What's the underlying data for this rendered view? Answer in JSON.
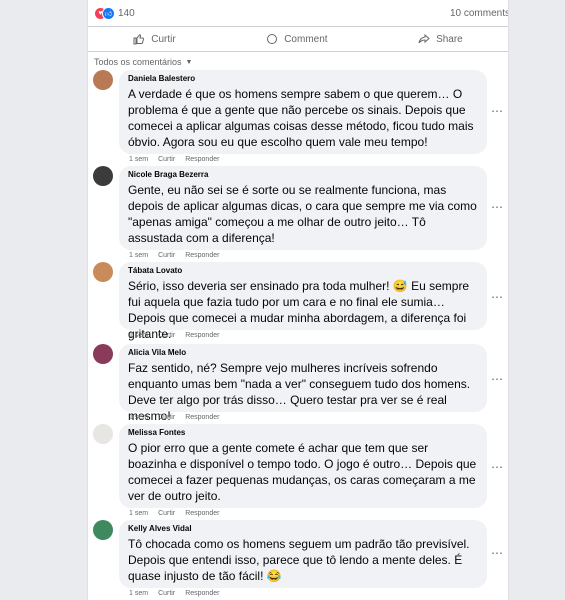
{
  "post": {
    "reaction_count": "140",
    "comments_count": "10 comments",
    "actions": {
      "like": "Curtir",
      "comment": "Comment",
      "share": "Share"
    },
    "sort_label": "Todos os comentários"
  },
  "comments": [
    {
      "author": "Daniela Balestero",
      "text": "A verdade é que os homens sempre sabem o que querem… O problema é que a gente que não percebe os sinais. Depois que comecei a aplicar algumas coisas desse método, ficou tudo mais óbvio. Agora sou eu que escolho quem vale meu tempo!",
      "time": "1 sem",
      "like": "Curtir",
      "reply": "Responder",
      "avatar_color": "#b77a55"
    },
    {
      "author": "Nicole Braga Bezerra",
      "text": "Gente, eu não sei se é sorte ou se realmente funciona, mas depois de aplicar algumas dicas, o cara que sempre me via como \"apenas amiga\" começou a me olhar de outro jeito… Tô assustada com a diferença!",
      "time": "1 sem",
      "like": "Curtir",
      "reply": "Responder",
      "avatar_color": "#3b3b3b"
    },
    {
      "author": "Tábata Lovato",
      "text": "Sério, isso deveria ser ensinado pra toda mulher! 😅 Eu sempre fui aquela que fazia tudo por um cara e no final ele sumia… Depois que comecei a mudar minha abordagem, a diferença foi gritante.",
      "time": "1 sem",
      "like": "Curtir",
      "reply": "Responder",
      "avatar_color": "#c98b5a"
    },
    {
      "author": "Alicia Vila Melo",
      "text": "Faz sentido, né? Sempre vejo mulheres incríveis sofrendo enquanto umas bem \"nada a ver\" conseguem tudo dos homens. Deve ter algo por trás disso… Quero testar pra ver se é real mesmo!",
      "time": "1 sem",
      "like": "Curtir",
      "reply": "Responder",
      "avatar_color": "#8a3a5a"
    },
    {
      "author": "Melissa Fontes",
      "text": "O pior erro que a gente comete é achar que tem que ser boazinha e disponível o tempo todo. O jogo é outro… Depois que comecei a fazer pequenas mudanças, os caras começaram a me ver de outro jeito.",
      "time": "1 sem",
      "like": "Curtir",
      "reply": "Responder",
      "avatar_color": "#e8e6e2"
    },
    {
      "author": "Kelly Alves Vidal",
      "text": "Tô chocada como os homens seguem um padrão tão previsível. Depois que entendi isso, parece que tô lendo a mente deles. É quase injusto de tão fácil! 😂",
      "time": "1 sem",
      "like": "Curtir",
      "reply": "Responder",
      "avatar_color": "#3e8a5e"
    }
  ],
  "icons": {
    "heart": "heart-icon",
    "like": "thumbs-up-icon",
    "comment": "speech-bubble-icon",
    "share": "share-arrow-icon",
    "chevron": "chevron-down-icon",
    "more": "ellipsis-icon"
  }
}
